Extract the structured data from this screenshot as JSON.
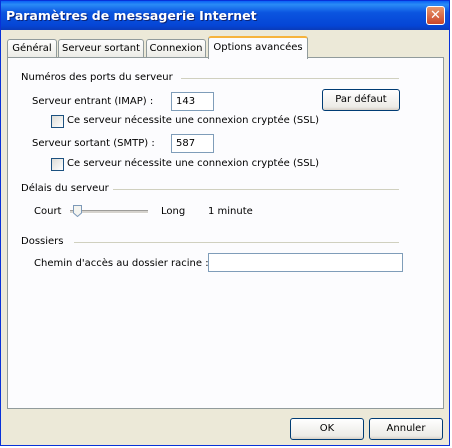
{
  "window": {
    "title": "Paramètres de messagerie Internet"
  },
  "tabs": [
    {
      "label": "Général"
    },
    {
      "label": "Serveur sortant"
    },
    {
      "label": "Connexion"
    },
    {
      "label": "Options avancées"
    }
  ],
  "ports": {
    "group_label": "Numéros des ports du serveur",
    "incoming_label": "Serveur entrant (IMAP) :",
    "incoming_value": "143",
    "incoming_ssl_label": "Ce serveur nécessite une connexion cryptée (SSL)",
    "outgoing_label": "Serveur sortant (SMTP) :",
    "outgoing_value": "587",
    "outgoing_ssl_label": "Ce serveur nécessite une connexion cryptée (SSL)",
    "default_button": "Par défaut"
  },
  "timeouts": {
    "group_label": "Délais du serveur",
    "short_label": "Court",
    "long_label": "Long",
    "value": "1 minute",
    "slider_fraction": 0.05
  },
  "folders": {
    "group_label": "Dossiers",
    "root_path_label": "Chemin d'accès au dossier racine :",
    "root_path_value": ""
  },
  "footer": {
    "ok_label": "OK",
    "cancel_label": "Annuler"
  },
  "colors": {
    "titlebar": "#0a55e0",
    "accent_tab": "#f6b33d",
    "background": "#ece9d8"
  }
}
